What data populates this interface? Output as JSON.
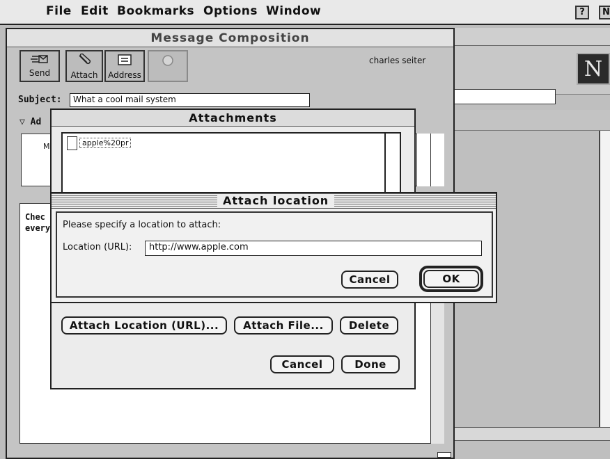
{
  "menubar": {
    "apple_glyph": "",
    "items": [
      "File",
      "Edit",
      "Bookmarks",
      "Options",
      "Window"
    ],
    "help_glyph": "?",
    "app_glyph": "N"
  },
  "compose": {
    "title": "Message Composition",
    "toolbar": [
      {
        "label": "Send",
        "icon": "send-icon",
        "glyph": "✉"
      },
      {
        "label": "Attach",
        "icon": "paperclip-icon",
        "glyph": "📎"
      },
      {
        "label": "Address",
        "icon": "address-book-icon",
        "glyph": "▤"
      },
      {
        "label": "",
        "icon": "stop-icon",
        "glyph": "◎"
      }
    ],
    "author": "charles seiter",
    "subject_label": "Subject:",
    "subject_value": "What a cool mail system",
    "addressing_label": "▽ Ad",
    "addressing_partial": "M",
    "body_text_line1": "Chec",
    "body_text_line2": "every"
  },
  "attachments": {
    "title": "Attachments",
    "files": [
      "apple%20pr"
    ],
    "buttons": {
      "attach_location": "Attach Location (URL)...",
      "attach_file": "Attach File...",
      "delete": "Delete",
      "cancel": "Cancel",
      "done": "Done"
    }
  },
  "attach_location": {
    "title": "Attach location",
    "prompt": "Please specify a location to attach:",
    "field_label": "Location (URL):",
    "field_value": "http://www.apple.com",
    "cancel": "Cancel",
    "ok": "OK"
  },
  "browser": {
    "logo": "N"
  }
}
